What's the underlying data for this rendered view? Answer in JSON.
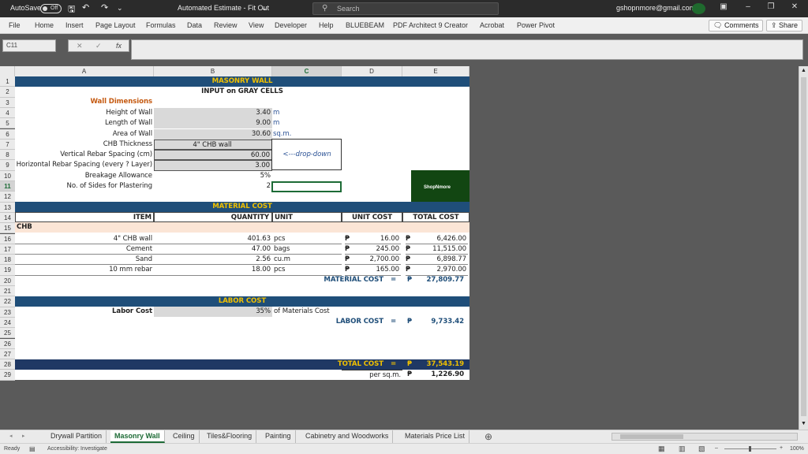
{
  "titlebar": {
    "autosave": "AutoSave",
    "toggle": "Off",
    "doc_title": "Automated Estimate - Fit Out",
    "search_placeholder": "Search",
    "account": "gshopnmore@gmail.com"
  },
  "ribbon": {
    "menus": [
      "File",
      "Home",
      "Insert",
      "Page Layout",
      "Formulas",
      "Data",
      "Review",
      "View",
      "Developer",
      "Help",
      "BLUEBEAM",
      "PDF Architect 9 Creator",
      "Acrobat",
      "Power Pivot"
    ],
    "comments": "Comments",
    "share": "Share"
  },
  "formula_bar": {
    "name_box": "C11",
    "fx": "fx",
    "value": ""
  },
  "columns": [
    "A",
    "B",
    "C",
    "D",
    "E"
  ],
  "rows": [
    "1",
    "2",
    "3",
    "4",
    "5",
    "6",
    "7",
    "8",
    "9",
    "10",
    "11",
    "12",
    "13",
    "14",
    "15",
    "16",
    "17",
    "18",
    "19",
    "20",
    "21",
    "22",
    "23",
    "24",
    "25",
    "26",
    "27",
    "28",
    "29"
  ],
  "sheet": {
    "title": "MASONRY WALL",
    "subtitle": "INPUT on GRAY CELLS",
    "wall_dimensions": "Wall Dimensions",
    "inputs": [
      {
        "label": "Height of Wall",
        "value": "3.40",
        "unit": "m"
      },
      {
        "label": "Length of Wall",
        "value": "9.00",
        "unit": "m"
      },
      {
        "label": "Area of Wall",
        "value": "30.60",
        "unit": "sq.m."
      },
      {
        "label": "CHB Thickness",
        "value": "4\" CHB wall",
        "unit": ""
      },
      {
        "label": "Vertical Rebar Spacing (cm)",
        "value": "60.00",
        "unit": ""
      },
      {
        "label": "Horizontal Rebar Spacing (every ? Layer)",
        "value": "3.00",
        "unit": ""
      },
      {
        "label": "Breakage Allowance",
        "value": "5%",
        "unit": ""
      },
      {
        "label": "No. of Sides for Plastering",
        "value": "2",
        "unit": ""
      }
    ],
    "dropdown_note": "<---drop-down",
    "logo_text": "ShopNmore",
    "material_cost": "MATERIAL COST",
    "headers": {
      "item": "ITEM",
      "quantity": "QUANTITY",
      "unit": "UNIT",
      "unit_cost": "UNIT COST",
      "total_cost": "TOTAL COST"
    },
    "chb": "CHB",
    "materials": [
      {
        "item": "4\" CHB wall",
        "qty": "401.63",
        "unit": "pcs",
        "cur": "₱",
        "unit_cost": "16.00",
        "total": "6,426.00"
      },
      {
        "item": "Cement",
        "qty": "47.00",
        "unit": "bags",
        "cur": "₱",
        "unit_cost": "245.00",
        "total": "11,515.00"
      },
      {
        "item": "Sand",
        "qty": "2.56",
        "unit": "cu.m",
        "cur": "₱",
        "unit_cost": "2,700.00",
        "total": "6,898.77"
      },
      {
        "item": "10 mm rebar",
        "qty": "18.00",
        "unit": "pcs",
        "cur": "₱",
        "unit_cost": "165.00",
        "total": "2,970.00"
      }
    ],
    "material_total": {
      "label": "MATERIAL COST",
      "eq": "=",
      "cur": "₱",
      "value": "27,809.77"
    },
    "labor_cost": "LABOR COST",
    "labor": {
      "label": "Labor Cost",
      "value": "35%",
      "note": "of Materials Cost"
    },
    "labor_total": {
      "label": "LABOR COST",
      "eq": "=",
      "cur": "₱",
      "value": "9,733.42"
    },
    "total": {
      "label": "TOTAL COST",
      "eq": "=",
      "cur": "₱",
      "value": "37,543.19"
    },
    "per_sqm": {
      "label": "per sq.m.",
      "cur": "₱",
      "value": "1,226.90"
    }
  },
  "tabs": [
    "Drywall Partition",
    "Masonry Wall",
    "Ceiling",
    "Tiles&Flooring",
    "Painting",
    "Cabinetry and Woodworks",
    "Materials Price List"
  ],
  "status": {
    "ready": "Ready",
    "accessibility": "Accessibility: Investigate",
    "zoom": "100%"
  }
}
